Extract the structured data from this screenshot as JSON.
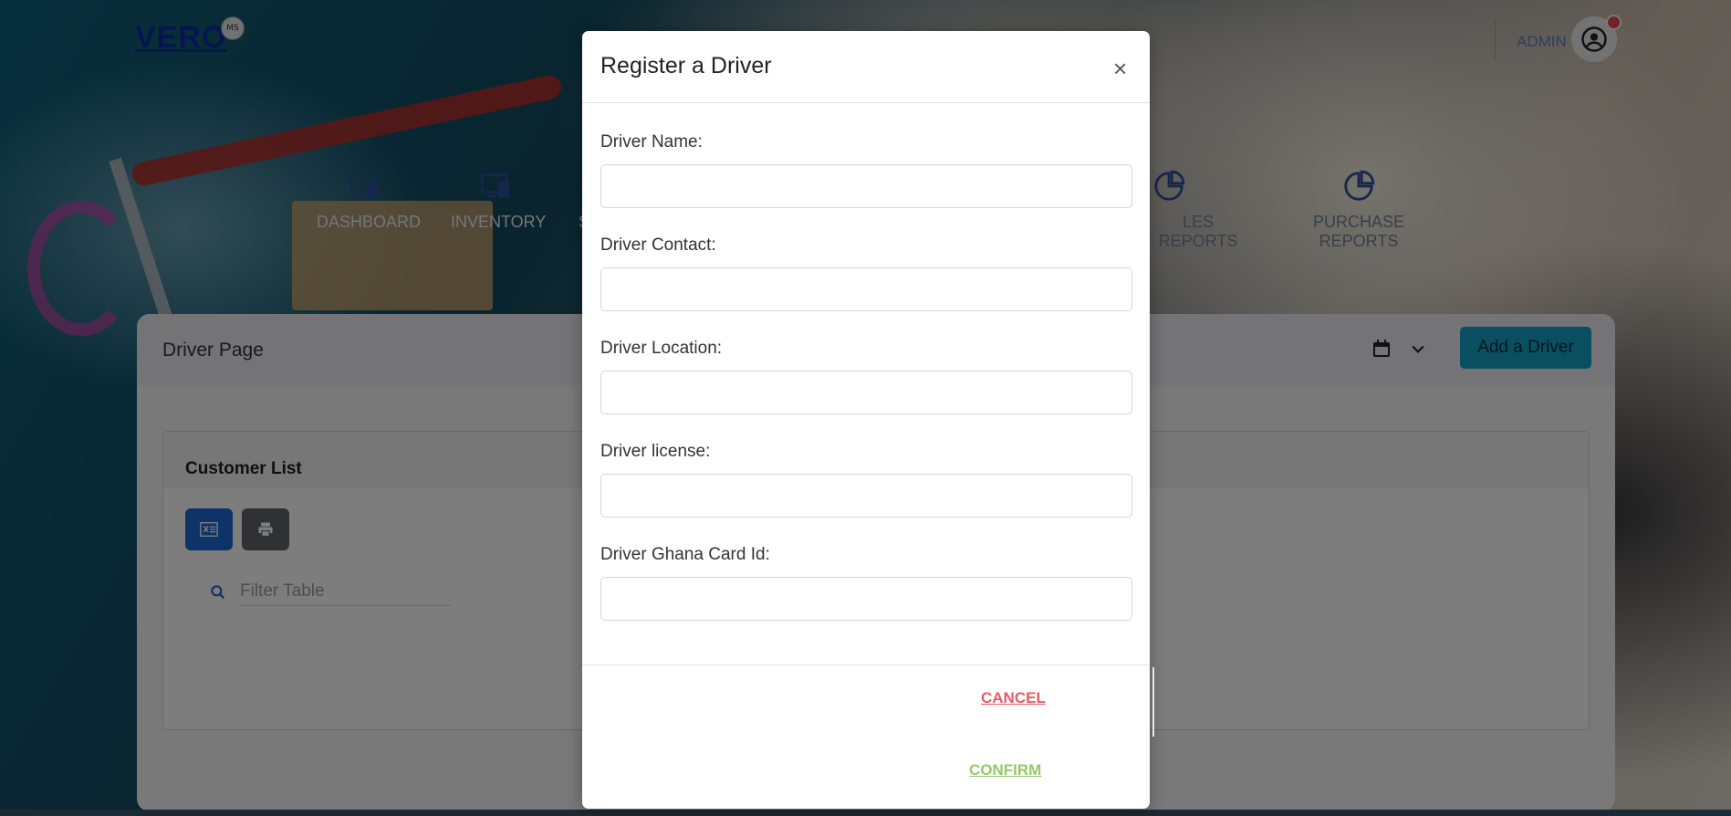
{
  "app": {
    "logo": "VERO",
    "logo_badge": "MS"
  },
  "header": {
    "admin_label": "ADMIN"
  },
  "nav": {
    "items": [
      {
        "label": "DASHBOARD",
        "icon": "devices-icon"
      },
      {
        "label": "INVENTORY",
        "icon": "devices-icon"
      },
      {
        "label": "S",
        "icon": "devices-icon"
      },
      {
        "label": "LES REPORTS",
        "icon": "pie-chart-icon"
      },
      {
        "label": "PURCHASE REPORTS",
        "icon": "pie-chart-icon"
      }
    ]
  },
  "page": {
    "title": "Driver Page",
    "add_button": "Add a Driver",
    "panel_title": "Customer List",
    "filter_placeholder": "Filter Table"
  },
  "modal": {
    "title": "Register a Driver",
    "close": "×",
    "fields": [
      {
        "label": "Driver Name:",
        "value": ""
      },
      {
        "label": "Driver Contact:",
        "value": ""
      },
      {
        "label": "Driver Location:",
        "value": ""
      },
      {
        "label": "Driver license:",
        "value": ""
      },
      {
        "label": "Driver Ghana Card Id:",
        "value": ""
      }
    ],
    "cancel": "CANCEL",
    "confirm": "CONFIRM"
  },
  "colors": {
    "accent": "#149fc3",
    "cancel": "#e85b61",
    "confirm": "#96c76a",
    "excel_button": "#1a66d1",
    "print_button": "#5f6367"
  }
}
